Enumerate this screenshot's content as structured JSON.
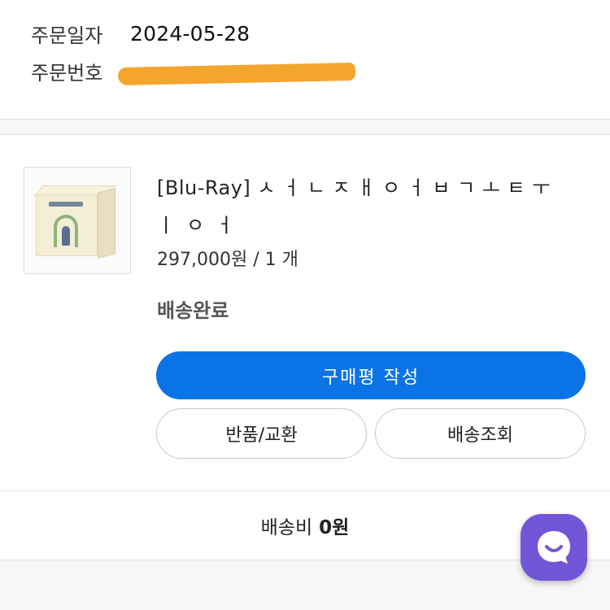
{
  "order": {
    "date_label": "주문일자",
    "date_value": "2024-05-28",
    "number_label": "주문번호"
  },
  "product": {
    "title_line1": "[Blu-Ray] ㅅ ㅓ ㄴ ㅈ ㅐ ㅇ ㅓ ㅂ ㄱ ㅗ ㅌ ㅜ",
    "title_line2": "ㅣㅇㅓ",
    "price": "297,000원 / 1 개",
    "status": "배송완료"
  },
  "actions": {
    "review_label": "구매평 작성",
    "return_label": "반품/교환",
    "tracking_label": "배송조회"
  },
  "shipping": {
    "label": "배송비",
    "fee": "0원"
  },
  "colors": {
    "primary_button": "#0a74e6",
    "chat_button": "#7256d8",
    "redaction": "#f3a52c"
  },
  "icons": {
    "chat": "chat-smile-icon"
  }
}
